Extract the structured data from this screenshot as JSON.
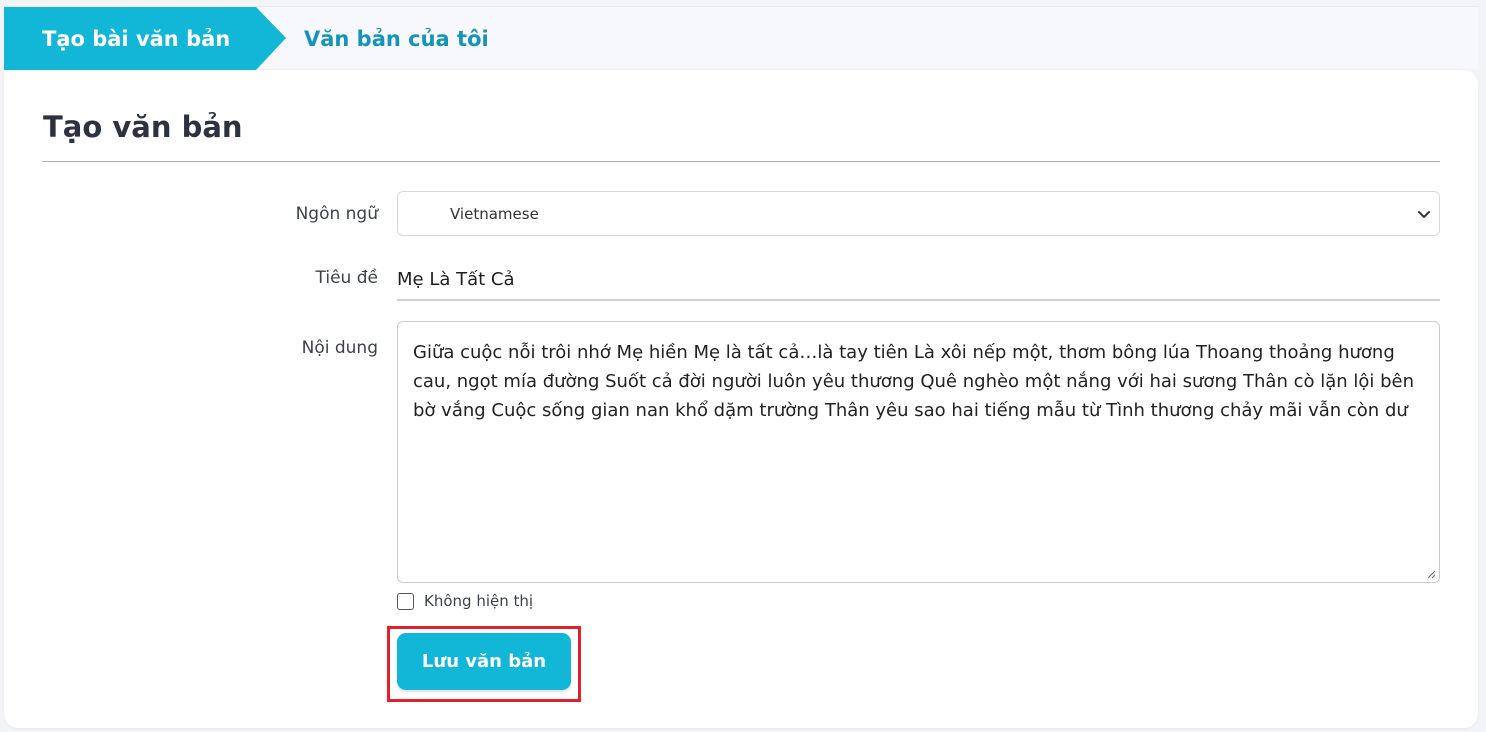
{
  "tabs": {
    "create_label": "Tạo bài văn bản",
    "mine_label": "Văn bản của tôi"
  },
  "form": {
    "heading": "Tạo văn bản",
    "language_label": "Ngôn ngữ",
    "language_value": "Vietnamese",
    "title_label": "Tiêu đề",
    "title_value": "Mẹ Là Tất Cả",
    "content_label": "Nội dung",
    "content_value": "Giữa cuộc nỗi trôi nhớ Mẹ hiền Mẹ là tất cả…là tay tiên Là xôi nếp một, thơm bông lúa Thoang thoảng hương cau, ngọt mía đường Suốt cả đời người luôn yêu thương Quê nghèo một nắng với hai sương Thân cò lặn lội bên bờ vắng Cuộc sống gian nan khổ dặm trường Thân yêu sao hai tiếng mẫu từ Tình thương chảy mãi vẫn còn dư",
    "hide_label": "Không hiện thị",
    "hide_checked": false,
    "save_label": "Lưu văn bản"
  },
  "colors": {
    "accent": "#12b6d6",
    "tab_text": "#1593b9",
    "highlight": "#e0202c"
  }
}
